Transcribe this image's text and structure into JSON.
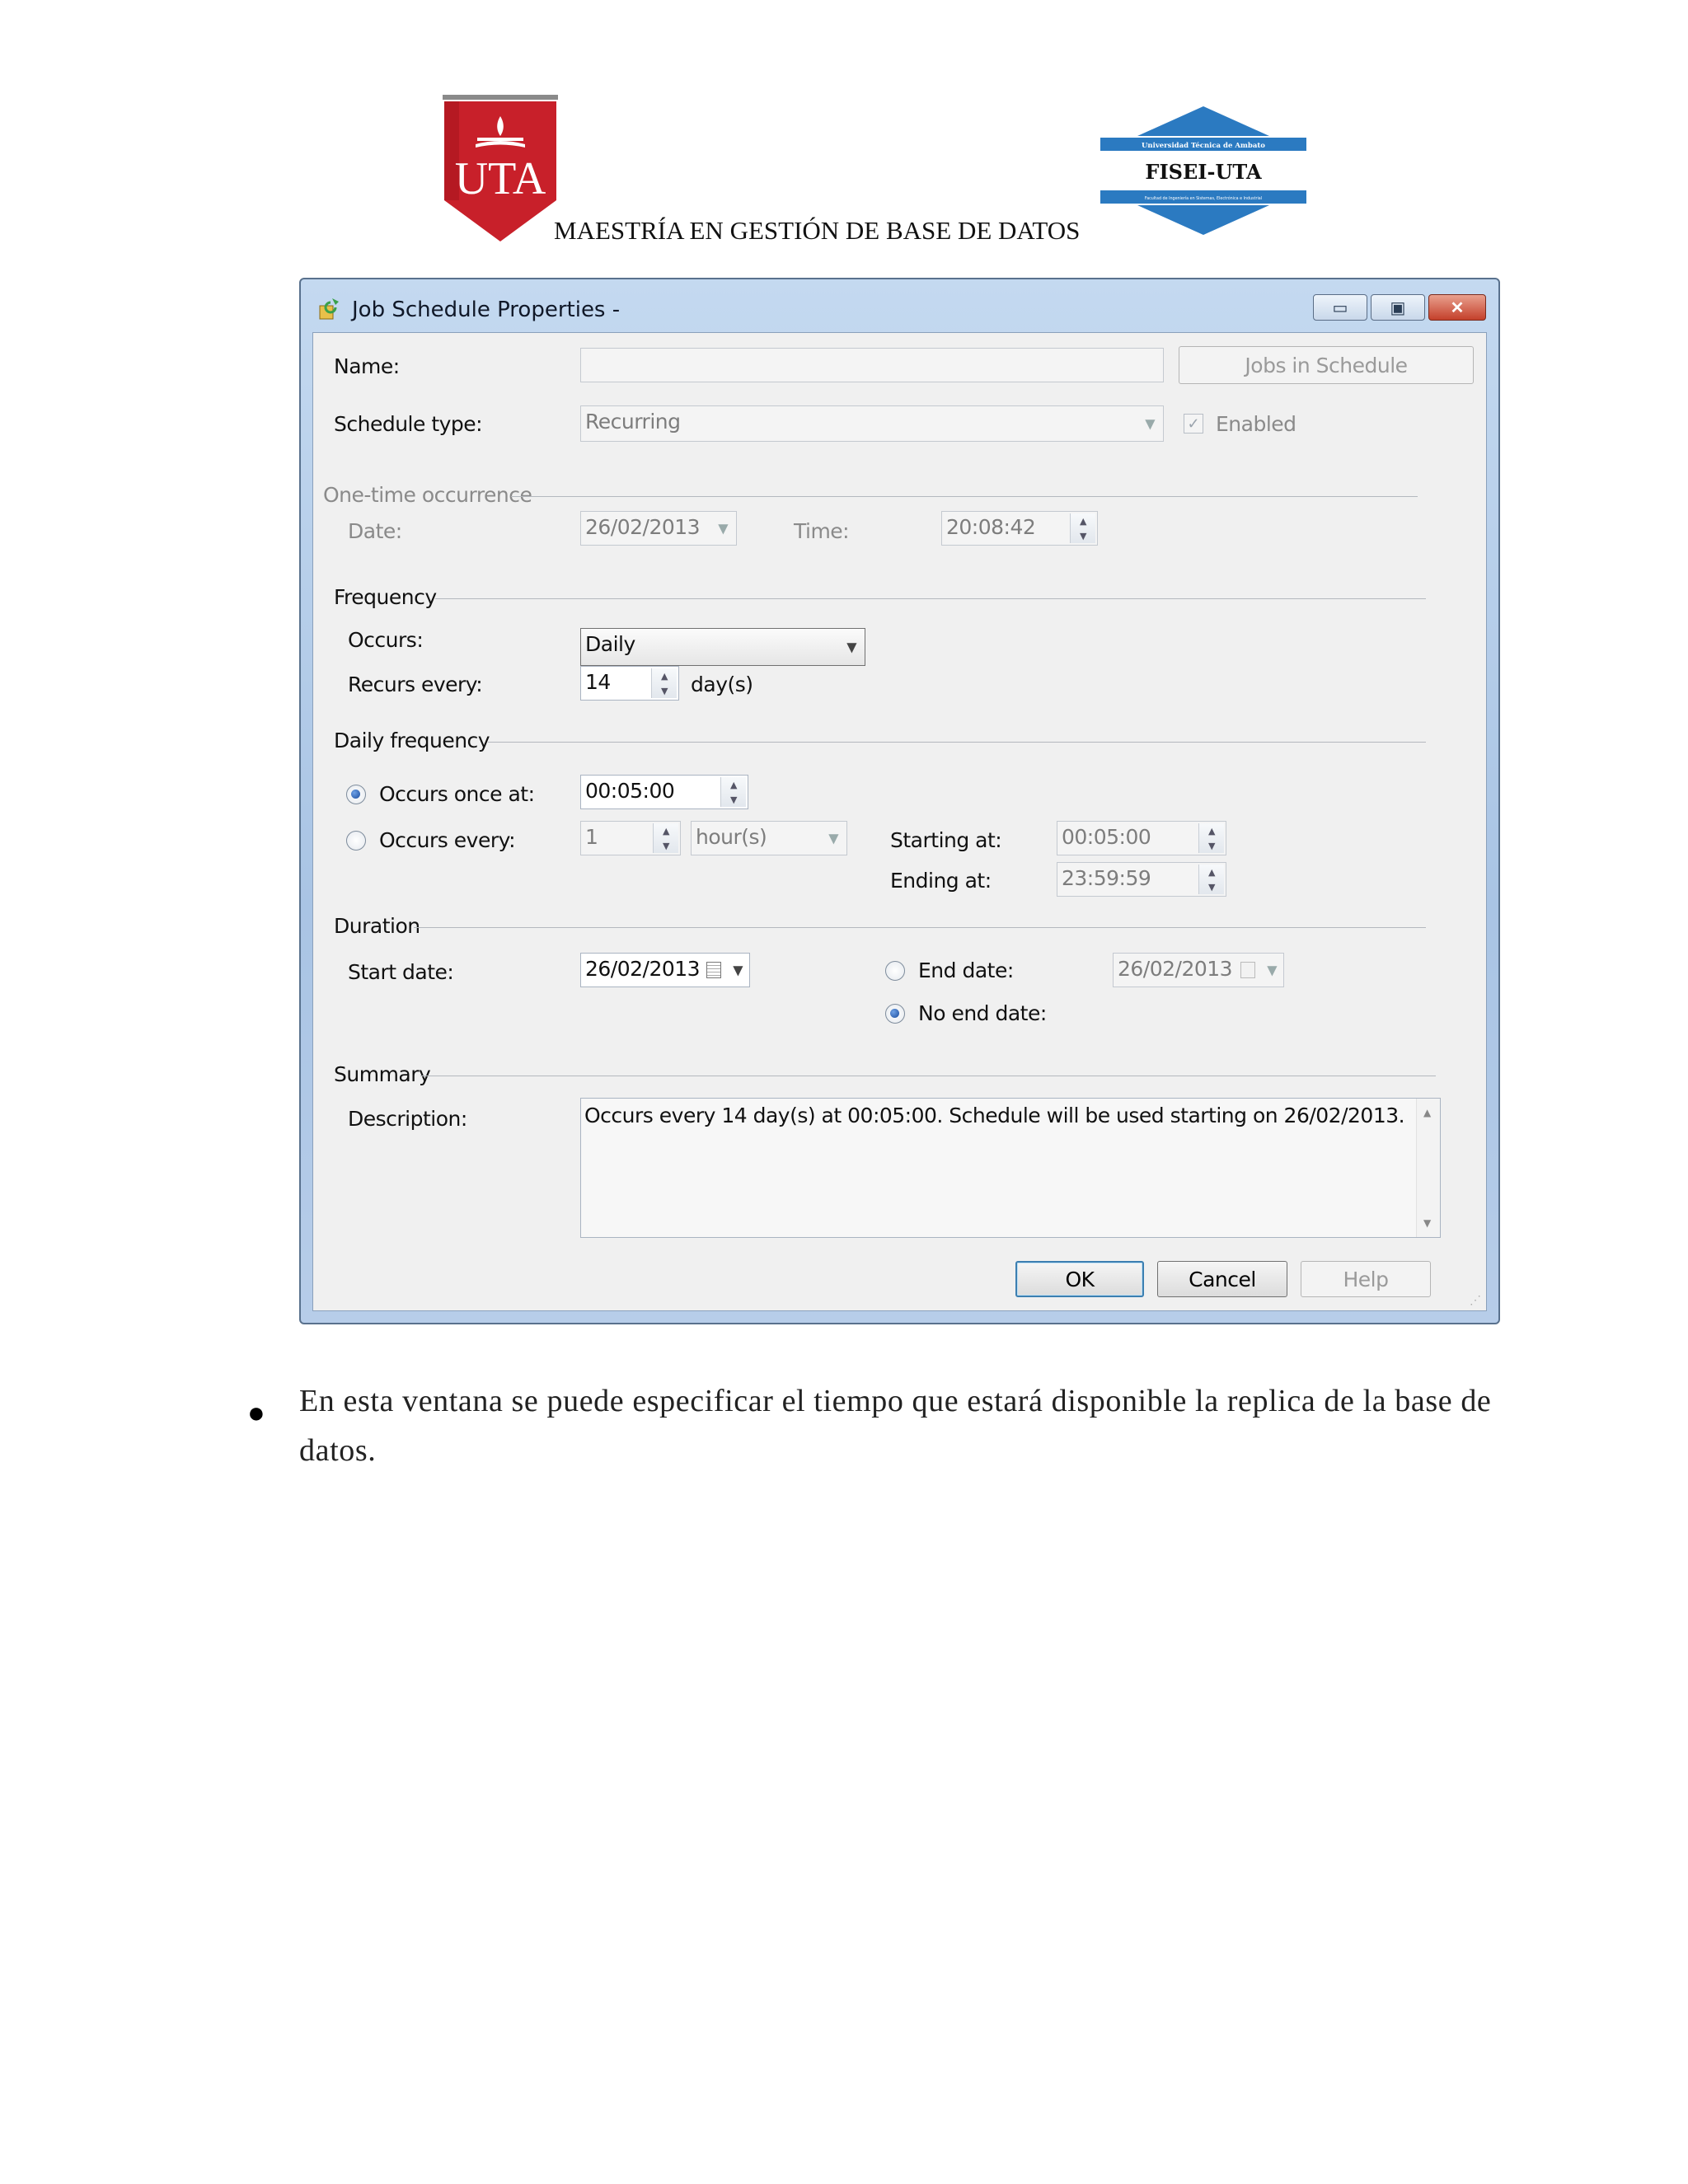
{
  "header": {
    "title": "MAESTRÍA EN GESTIÓN DE BASE DE DATOS",
    "uta_logo_text": "UTA",
    "fisei_logo_top": "Universidad Técnica de Ambato",
    "fisei_logo_name": "FISEI-UTA",
    "fisei_logo_sub": "Facultad de Ingeniería en Sistemas, Electrónica e Industrial",
    "colors": {
      "uta_red": "#c8202a",
      "fisei_blue": "#2b7ac1"
    }
  },
  "dialog": {
    "title": "Job Schedule Properties -",
    "name": {
      "label": "Name:",
      "value": ""
    },
    "jobs_button": "Jobs in Schedule",
    "schedule_type": {
      "label": "Schedule type:",
      "value": "Recurring"
    },
    "enabled": {
      "label": "Enabled",
      "checked": true
    },
    "one_time": {
      "section": "One-time occurrence",
      "date_label": "Date:",
      "date_value": "26/02/2013",
      "time_label": "Time:",
      "time_value": "20:08:42"
    },
    "frequency": {
      "section": "Frequency",
      "occurs_label": "Occurs:",
      "occurs_value": "Daily",
      "recurs_label": "Recurs every:",
      "recurs_value": "14",
      "recurs_unit": "day(s)"
    },
    "daily": {
      "section": "Daily frequency",
      "once_label": "Occurs once at:",
      "once_value": "00:05:00",
      "every_label": "Occurs every:",
      "every_value": "1",
      "every_unit": "hour(s)",
      "starting_label": "Starting at:",
      "starting_value": "00:05:00",
      "ending_label": "Ending at:",
      "ending_value": "23:59:59"
    },
    "duration": {
      "section": "Duration",
      "start_label": "Start date:",
      "start_value": "26/02/2013",
      "end_label": "End date:",
      "end_value": "26/02/2013",
      "noend_label": "No end date:"
    },
    "summary": {
      "section": "Summary",
      "desc_label": "Description:",
      "desc_value": "Occurs every 14 day(s) at 00:05:00. Schedule will be used starting on 26/02/2013."
    },
    "buttons": {
      "ok": "OK",
      "cancel": "Cancel",
      "help": "Help"
    }
  },
  "body_text": "En esta ventana se puede especificar el tiempo que estará disponible la replica de la base de datos."
}
